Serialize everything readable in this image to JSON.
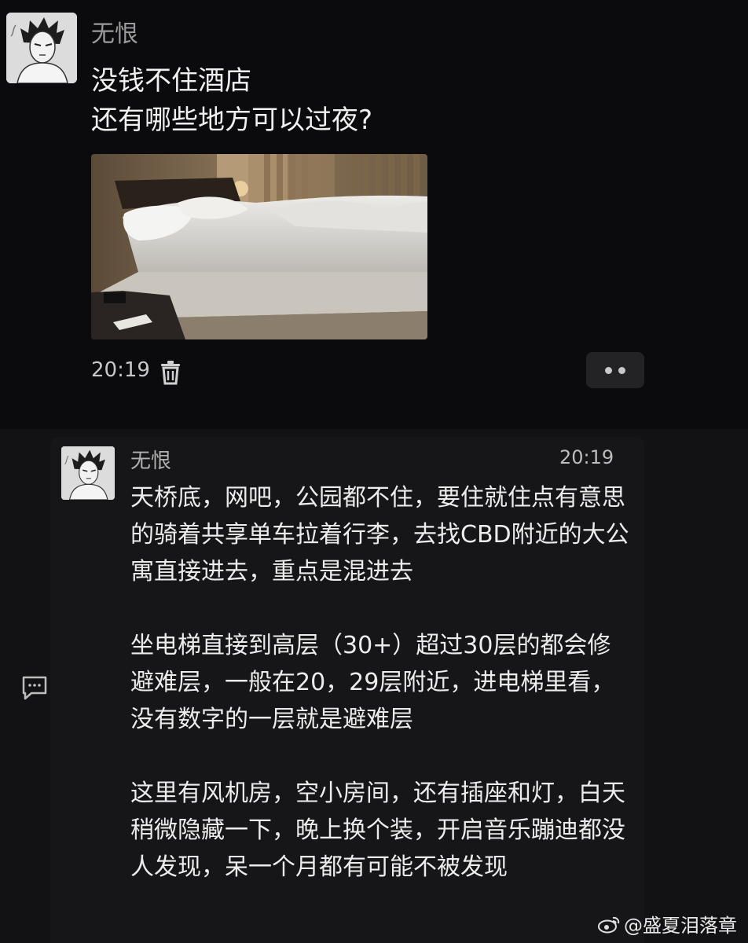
{
  "post": {
    "username": "无恨",
    "text_line1": "没钱不住酒店",
    "text_line2": "还有哪些地方可以过夜?",
    "time": "20:19"
  },
  "comment": {
    "username": "无恨",
    "time": "20:19",
    "paragraph1": "天桥底，网吧，公园都不住，要住就住点有意思的骑着共享单车拉着行李，去找CBD附近的大公寓直接进去，重点是混进去",
    "paragraph2": "坐电梯直接到高层（30+）超过30层的都会修避难层，一般在20，29层附近，进电梯里看，没有数字的一层就是避难层",
    "paragraph3": "这里有风机房，空小房间，还有插座和灯，白天稍微隐藏一下，晚上换个装，开启音乐蹦迪都没人发现，呆一个月都有可能不被发现"
  },
  "watermark": "@盛夏泪落章",
  "icons": {
    "delete": "trash-icon",
    "more": "more-dots-icon",
    "reply": "comment-bubble-icon",
    "watermark": "weibo-logo-icon"
  },
  "colors": {
    "background": "#0b0b0d",
    "comment_panel": "#161618",
    "text_primary": "#f0f0f0",
    "text_secondary": "#9a9a9a"
  }
}
